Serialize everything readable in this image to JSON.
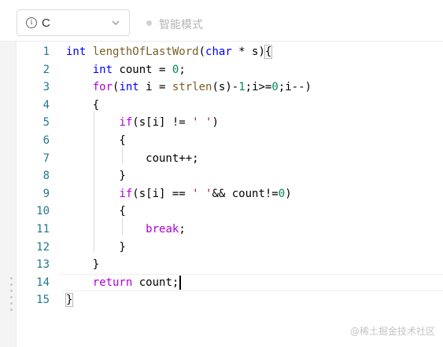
{
  "toolbar": {
    "language": "C",
    "mode_label": "智能模式",
    "icons": {
      "info": "info-icon",
      "chevron": "chevron-down-icon",
      "dot": "status-dot-icon"
    }
  },
  "colors": {
    "keyword": "#0000ff",
    "control": "#af00db",
    "number": "#098658",
    "string": "#a31515",
    "function": "#795e26",
    "text": "#000000",
    "line_number": "#237893"
  },
  "editor": {
    "current_line": 14,
    "lines": [
      {
        "n": "1",
        "tokens": [
          [
            "int",
            "keyword"
          ],
          [
            " ",
            "text"
          ],
          [
            "lengthOfLastWord",
            "function"
          ],
          [
            "(",
            "text"
          ],
          [
            "char",
            "keyword"
          ],
          [
            " * s)",
            "text"
          ],
          [
            "{",
            "bracket"
          ]
        ]
      },
      {
        "n": "2",
        "tokens": [
          [
            "    ",
            "text"
          ],
          [
            "int",
            "keyword"
          ],
          [
            " count = ",
            "text"
          ],
          [
            "0",
            "number"
          ],
          [
            ";",
            "text"
          ]
        ]
      },
      {
        "n": "3",
        "tokens": [
          [
            "    ",
            "text"
          ],
          [
            "for",
            "control"
          ],
          [
            "(",
            "text"
          ],
          [
            "int",
            "keyword"
          ],
          [
            " i = ",
            "text"
          ],
          [
            "strlen",
            "function"
          ],
          [
            "(s)-",
            "text"
          ],
          [
            "1",
            "number"
          ],
          [
            ";i>=",
            "text"
          ],
          [
            "0",
            "number"
          ],
          [
            ";i--)",
            "text"
          ]
        ]
      },
      {
        "n": "4",
        "tokens": [
          [
            "    {",
            "text"
          ]
        ]
      },
      {
        "n": "5",
        "tokens": [
          [
            "        ",
            "text"
          ],
          [
            "if",
            "control"
          ],
          [
            "(s[i] != ",
            "text"
          ],
          [
            "' '",
            "string"
          ],
          [
            ")",
            "text"
          ]
        ]
      },
      {
        "n": "6",
        "tokens": [
          [
            "        {",
            "text"
          ]
        ]
      },
      {
        "n": "7",
        "tokens": [
          [
            "            count++;",
            "text"
          ]
        ]
      },
      {
        "n": "8",
        "tokens": [
          [
            "        }",
            "text"
          ]
        ]
      },
      {
        "n": "9",
        "tokens": [
          [
            "        ",
            "text"
          ],
          [
            "if",
            "control"
          ],
          [
            "(s[i] == ",
            "text"
          ],
          [
            "' '",
            "string"
          ],
          [
            "&& count!=",
            "text"
          ],
          [
            "0",
            "number"
          ],
          [
            ")",
            "text"
          ]
        ]
      },
      {
        "n": "10",
        "tokens": [
          [
            "        {",
            "text"
          ]
        ]
      },
      {
        "n": "11",
        "tokens": [
          [
            "            ",
            "text"
          ],
          [
            "break",
            "control"
          ],
          [
            ";",
            "text"
          ]
        ]
      },
      {
        "n": "12",
        "tokens": [
          [
            "        }",
            "text"
          ]
        ]
      },
      {
        "n": "13",
        "tokens": [
          [
            "    }",
            "text"
          ]
        ]
      },
      {
        "n": "14",
        "tokens": [
          [
            "    ",
            "text"
          ],
          [
            "return",
            "control"
          ],
          [
            " count;",
            "text"
          ]
        ]
      },
      {
        "n": "15",
        "tokens": [
          [
            "}",
            "bracket"
          ]
        ]
      }
    ]
  },
  "watermark": "@稀土掘金技术社区"
}
